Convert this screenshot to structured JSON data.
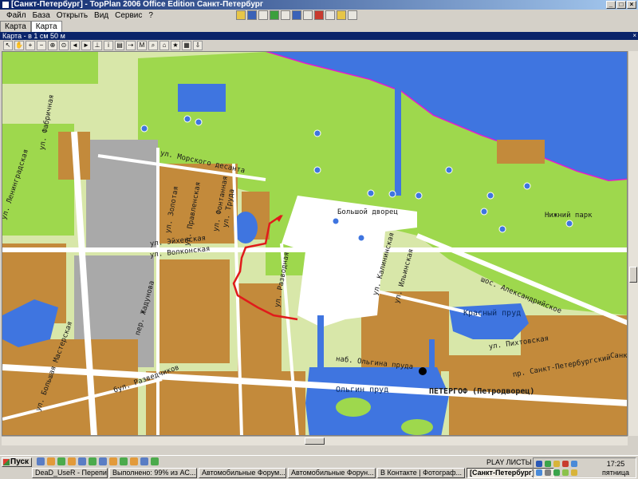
{
  "window": {
    "title": "[Санкт-Петербург] - TopPlan 2006 Office Edition Санкт-Петербург",
    "minimize": "_",
    "maximize": "□",
    "close": "×"
  },
  "menu": [
    "Файл",
    "База",
    "Открыть",
    "Вид",
    "Сервис",
    "?"
  ],
  "tabs": [
    "Карта",
    "Карта"
  ],
  "panel": {
    "title": "Карта - в 1 см 50 м",
    "close": "×"
  },
  "map": {
    "colors": {
      "park": "#9ed84d",
      "built": "#c38a3b",
      "industrial": "#a9a9a9",
      "water": "#3f75e0",
      "road": "#ffffff",
      "route": "#e01b1b",
      "shore": "#e01bd0"
    },
    "labels": {
      "morskogo": "ул. Морского десанта",
      "leningradskaya": "ул. Ленинградская",
      "fabrichnaya": "ул. Фабричная",
      "zolotaya": "ул. Золотая",
      "pravleniya": "ул. Правленская",
      "trud": "ул. Труда",
      "aivazovskaya": "ул. Эйхенская",
      "volkonskaya": "ул. Волконская",
      "razvodnaya": "ул. Разводная",
      "palace": "Большой дворец",
      "lower_park": "Нижний парк",
      "aleksandriyskoe": "шос. Александрийское",
      "krasny_prud": "Красный пруд",
      "pikhtarskaya": "ул. Пихтовская",
      "pr_spb": "пр. Санкт-Петербургский",
      "olgin_prud": "Ольгин пруд",
      "peterhof": "ПЕТЕРГОФ (Петродворец)",
      "nab_olgina": "наб. Ольгина пруда",
      "razvedchikov": "бул. Разведчиков",
      "bolshaya": "ул. Большая Мастерская",
      "kalininskaya": "ул. Калининская",
      "sankt": "Санкт",
      "pl_ilinskaya": "ул. Ильинская",
      "fontannaya": "ул. Фонтанная",
      "zhadunova": "пер. Жадунова"
    }
  },
  "taskbar": {
    "start": "Пуск",
    "tasks": [
      "DeaD_UseR - Переписка",
      "Выполнено: 99% из АС...",
      "Автомобильные Форум...",
      "Автомобильные Форун...",
      "В Контакте | Фотограф...",
      "[Санкт-Петербург] ..."
    ],
    "play": "PLAY ЛИСТЫ",
    "time": "17:25",
    "day": "пятница"
  }
}
